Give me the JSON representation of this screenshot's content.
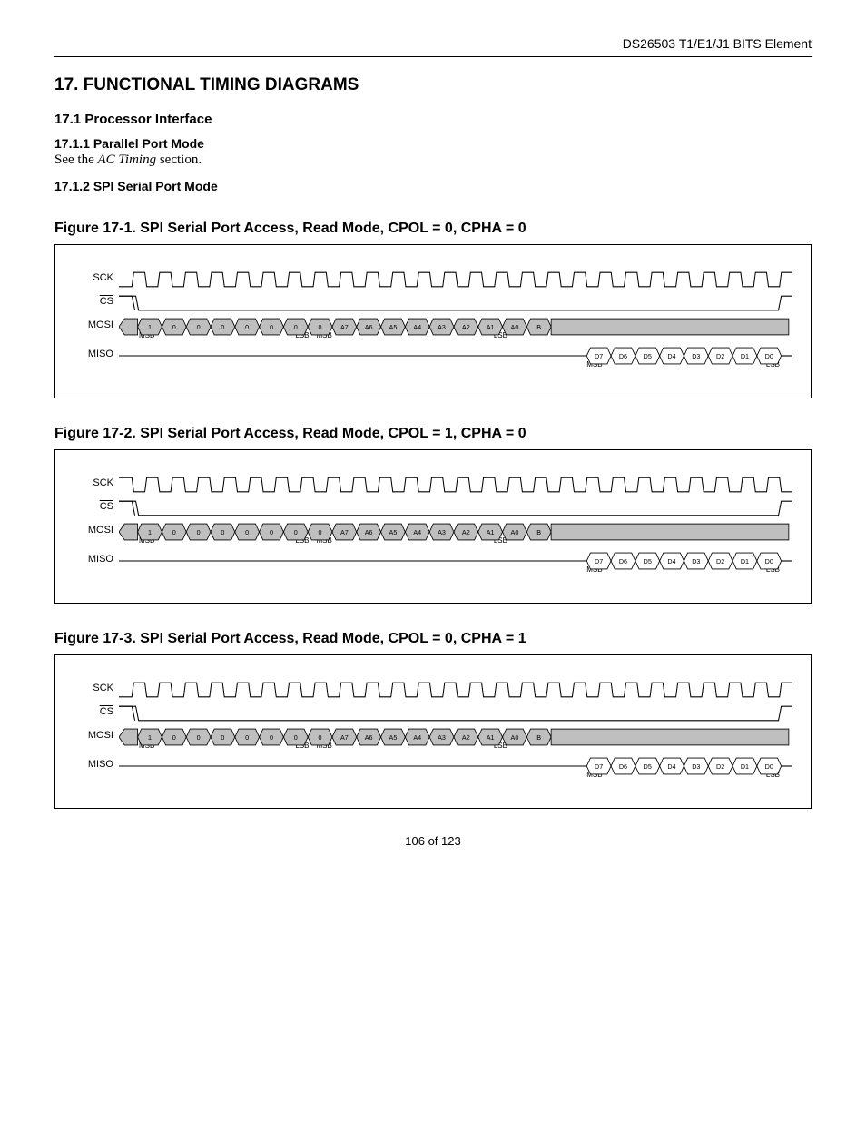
{
  "header": {
    "doc_id": "DS26503 T1/E1/J1 BITS Element"
  },
  "h1": "17.  FUNCTIONAL TIMING DIAGRAMS",
  "h2_1": "17.1  Processor Interface",
  "h3_1": "17.1.1  Parallel Port Mode",
  "body1_a": "See the ",
  "body1_b": "AC Timing",
  "body1_c": " section.",
  "h3_2": "17.1.2  SPI Serial Port Mode",
  "figures": [
    {
      "caption": "Figure 17-1. SPI Serial Port Access, Read Mode, CPOL = 0, CPHA = 0",
      "sck_start": "low",
      "signals": [
        "SCK",
        "CS",
        "MOSI",
        "MISO"
      ],
      "mosi_cells": [
        "1",
        "0",
        "0",
        "0",
        "0",
        "0",
        "0",
        "0",
        "A7",
        "A6",
        "A5",
        "A4",
        "A3",
        "A2",
        "A1",
        "A0",
        "B"
      ],
      "mosi_sub": {
        "left1": "MSB",
        "mid1": "LSB",
        "mid2": "MSB",
        "right": "LSB"
      },
      "miso_cells": [
        "D7",
        "D6",
        "D5",
        "D4",
        "D3",
        "D2",
        "D1",
        "D0"
      ],
      "miso_sub": {
        "left": "MSB",
        "right": "LSB"
      }
    },
    {
      "caption": "Figure 17-2. SPI Serial Port Access, Read Mode, CPOL = 1, CPHA = 0",
      "sck_start": "high",
      "signals": [
        "SCK",
        "CS",
        "MOSI",
        "MISO"
      ],
      "mosi_cells": [
        "1",
        "0",
        "0",
        "0",
        "0",
        "0",
        "0",
        "0",
        "A7",
        "A6",
        "A5",
        "A4",
        "A3",
        "A2",
        "A1",
        "A0",
        "B"
      ],
      "mosi_sub": {
        "left1": "MSB",
        "mid1": "LSB",
        "mid2": "MSB",
        "right": "LSB"
      },
      "miso_cells": [
        "D7",
        "D6",
        "D5",
        "D4",
        "D3",
        "D2",
        "D1",
        "D0"
      ],
      "miso_sub": {
        "left": "MSB",
        "right": "LSB"
      }
    },
    {
      "caption": "Figure 17-3. SPI Serial Port Access, Read Mode, CPOL = 0, CPHA = 1",
      "sck_start": "low",
      "signals": [
        "SCK",
        "CS",
        "MOSI",
        "MISO"
      ],
      "mosi_cells": [
        "1",
        "0",
        "0",
        "0",
        "0",
        "0",
        "0",
        "0",
        "A7",
        "A6",
        "A5",
        "A4",
        "A3",
        "A2",
        "A1",
        "A0",
        "B"
      ],
      "mosi_sub": {
        "left1": "MSB",
        "mid1": "LSB",
        "mid2": "MSB",
        "right": "LSB"
      },
      "miso_cells": [
        "D7",
        "D6",
        "D5",
        "D4",
        "D3",
        "D2",
        "D1",
        "D0"
      ],
      "miso_sub": {
        "left": "MSB",
        "right": "LSB"
      }
    }
  ],
  "footer": "106 of 123"
}
